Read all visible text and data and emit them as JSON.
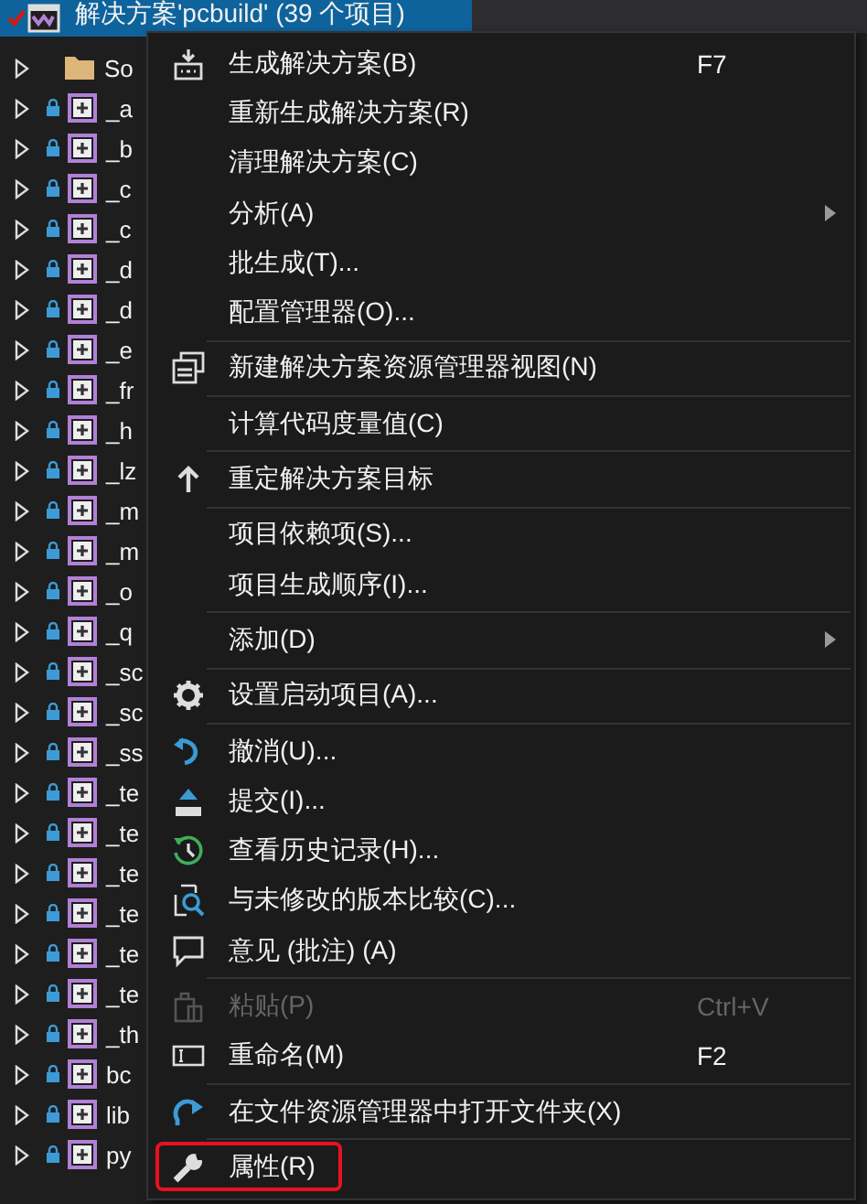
{
  "tree": {
    "header": {
      "label": "解决方案'pcbuild' (39 个项目)",
      "selected": true,
      "checked": true
    },
    "items": [
      {
        "label": "So",
        "kind": "folder"
      },
      {
        "label": "_a",
        "kind": "project"
      },
      {
        "label": "_b",
        "kind": "project"
      },
      {
        "label": "_c",
        "kind": "project"
      },
      {
        "label": "_c",
        "kind": "project"
      },
      {
        "label": "_d",
        "kind": "project"
      },
      {
        "label": "_d",
        "kind": "project"
      },
      {
        "label": "_e",
        "kind": "project"
      },
      {
        "label": "_fr",
        "kind": "project"
      },
      {
        "label": "_h",
        "kind": "project"
      },
      {
        "label": "_lz",
        "kind": "project"
      },
      {
        "label": "_m",
        "kind": "project"
      },
      {
        "label": "_m",
        "kind": "project"
      },
      {
        "label": "_o",
        "kind": "project"
      },
      {
        "label": "_q",
        "kind": "project"
      },
      {
        "label": "_sc",
        "kind": "project"
      },
      {
        "label": "_sc",
        "kind": "project"
      },
      {
        "label": "_ss",
        "kind": "project"
      },
      {
        "label": "_te",
        "kind": "project"
      },
      {
        "label": "_te",
        "kind": "project"
      },
      {
        "label": "_te",
        "kind": "project"
      },
      {
        "label": "_te",
        "kind": "project"
      },
      {
        "label": "_te",
        "kind": "project"
      },
      {
        "label": "_te",
        "kind": "project"
      },
      {
        "label": "_th",
        "kind": "project"
      },
      {
        "label": "bc",
        "kind": "project"
      },
      {
        "label": "lib",
        "kind": "project"
      },
      {
        "label": "py",
        "kind": "project"
      }
    ]
  },
  "context_menu": {
    "groups": [
      {
        "items": [
          {
            "label": "生成解决方案(B)",
            "shortcut": "F7",
            "submenu": false,
            "disabled": false,
            "annotated": false
          },
          {
            "label": "重新生成解决方案(R)",
            "submenu": false,
            "disabled": false,
            "annotated": false
          },
          {
            "label": "清理解决方案(C)",
            "submenu": false,
            "disabled": false,
            "annotated": false
          },
          {
            "label": "分析(A)",
            "submenu": true,
            "disabled": false,
            "annotated": false
          },
          {
            "label": "批生成(T)...",
            "submenu": false,
            "disabled": false,
            "annotated": false
          },
          {
            "label": "配置管理器(O)...",
            "submenu": false,
            "disabled": false,
            "annotated": false
          }
        ]
      },
      {
        "items": [
          {
            "label": "新建解决方案资源管理器视图(N)",
            "submenu": false,
            "disabled": false,
            "annotated": false
          }
        ]
      },
      {
        "items": [
          {
            "label": "计算代码度量值(C)",
            "submenu": false,
            "disabled": false,
            "annotated": false
          }
        ]
      },
      {
        "items": [
          {
            "label": "重定解决方案目标",
            "submenu": false,
            "disabled": false,
            "annotated": false
          }
        ]
      },
      {
        "items": [
          {
            "label": "项目依赖项(S)...",
            "submenu": false,
            "disabled": false,
            "annotated": false
          },
          {
            "label": "项目生成顺序(I)...",
            "submenu": false,
            "disabled": false,
            "annotated": false
          }
        ]
      },
      {
        "items": [
          {
            "label": "添加(D)",
            "submenu": true,
            "disabled": false,
            "annotated": false
          }
        ]
      },
      {
        "items": [
          {
            "label": "设置启动项目(A)...",
            "submenu": false,
            "disabled": false,
            "annotated": false
          }
        ]
      },
      {
        "items": [
          {
            "label": "撤消(U)...",
            "submenu": false,
            "disabled": false,
            "annotated": false
          },
          {
            "label": "提交(I)...",
            "submenu": false,
            "disabled": false,
            "annotated": false
          },
          {
            "label": "查看历史记录(H)...",
            "submenu": false,
            "disabled": false,
            "annotated": false
          },
          {
            "label": "与未修改的版本比较(C)...",
            "submenu": false,
            "disabled": false,
            "annotated": false
          },
          {
            "label": "意见 (批注) (A)",
            "submenu": false,
            "disabled": false,
            "annotated": false
          }
        ]
      },
      {
        "items": [
          {
            "label": "粘贴(P)",
            "shortcut": "Ctrl+V",
            "submenu": false,
            "disabled": true,
            "annotated": false
          },
          {
            "label": "重命名(M)",
            "shortcut": "F2",
            "submenu": false,
            "disabled": false,
            "annotated": false
          }
        ]
      },
      {
        "items": [
          {
            "label": "在文件资源管理器中打开文件夹(X)",
            "submenu": false,
            "disabled": false,
            "annotated": false
          }
        ]
      },
      {
        "items": [
          {
            "label": "属性(R)",
            "submenu": false,
            "disabled": false,
            "annotated": true
          }
        ]
      }
    ]
  }
}
